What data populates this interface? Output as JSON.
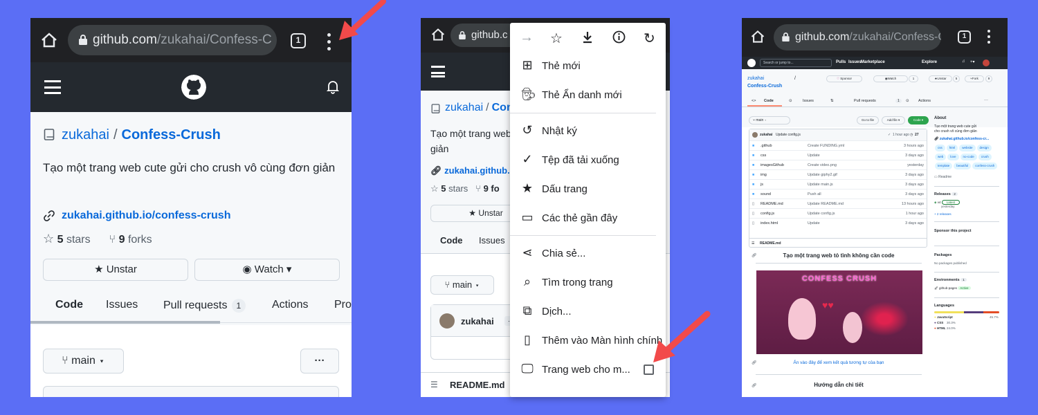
{
  "panel1": {
    "url_host": "github.com",
    "url_path": "/zukahai/Confess-C",
    "tab_count": "1",
    "owner": "zukahai",
    "separator": "/",
    "repo": "Confess-Crush",
    "description": "Tạo một trang web cute gửi cho crush vô cùng đơn giản",
    "website": "zukahai.github.io/confess-crush",
    "stars_count": "5",
    "stars_label": "stars",
    "forks_count": "9",
    "forks_label": "forks",
    "unstar": "Unstar",
    "watch": "Watch",
    "tabs": [
      "Code",
      "Issues",
      "Pull requests",
      "Actions",
      "Pro"
    ],
    "pr_count": "1",
    "branch": "main",
    "more": "···"
  },
  "panel2": {
    "url_host": "github.c",
    "owner": "zukahai",
    "separator": "/",
    "repo_part": "Con",
    "desc_part": "Tạo một trang web",
    "desc_part2": "giản",
    "website_part": "zukahai.github.io",
    "stars_count": "5",
    "stars_label": "stars",
    "forks_part": "9 fo",
    "unstar": "Unstar",
    "tabs": [
      "Code",
      "Issues"
    ],
    "branch": "main",
    "commit_user": "zukahai",
    "commit_more": "···",
    "readme": "README.md",
    "menu": [
      {
        "label": "Thẻ mới",
        "icon": "new-tab-icon"
      },
      {
        "label": "Thẻ Ẩn danh mới",
        "icon": "incognito-icon"
      },
      {
        "label": "Nhật ký",
        "icon": "history-icon"
      },
      {
        "label": "Tệp đã tải xuống",
        "icon": "downloads-icon"
      },
      {
        "label": "Dấu trang",
        "icon": "bookmarks-icon"
      },
      {
        "label": "Các thẻ gần đây",
        "icon": "recent-tabs-icon"
      },
      {
        "label": "Chia sẻ...",
        "icon": "share-icon"
      },
      {
        "label": "Tìm trong trang",
        "icon": "find-icon"
      },
      {
        "label": "Dịch...",
        "icon": "translate-icon"
      },
      {
        "label": "Thêm vào Màn hình chính",
        "icon": "add-home-icon"
      },
      {
        "label": "Trang web cho m...",
        "icon": "desktop-icon"
      }
    ]
  },
  "panel3": {
    "url_host": "github.com",
    "url_path": "/zukahai/Confess-C",
    "tab_count": "1",
    "search_placeholder": "Search or jump to...",
    "nav": [
      "Pulls",
      "Issues",
      "Marketplace",
      "Explore"
    ],
    "owner": "zukahai",
    "separator": "/",
    "repo": "Confess-Crush",
    "sponsor": "Sponsor",
    "watch": "Watch",
    "watch_count": "1",
    "unstar": "Unstar",
    "star_count": "5",
    "fork": "Fork",
    "fork_count": "9",
    "tabs": [
      "Code",
      "Issues",
      "Pull requests",
      "Actions"
    ],
    "pr_count": "1",
    "branch": "main",
    "go_to_file": "Go to file",
    "add_file": "Add file",
    "code_btn": "Code",
    "commit_user": "zukahai",
    "commit_msg": "Update config.js",
    "commit_time": "1 hour ago",
    "commit_count": "27",
    "files": [
      {
        "name": ".github",
        "msg": "Create FUNDING.yml",
        "time": "3 hours ago"
      },
      {
        "name": "css",
        "msg": "Update",
        "time": "3 days ago"
      },
      {
        "name": "imagesGithub",
        "msg": "Create video.png",
        "time": "yesterday"
      },
      {
        "name": "img",
        "msg": "Update giphy2.gif",
        "time": "3 days ago"
      },
      {
        "name": "js",
        "msg": "Update main.js",
        "time": "3 days ago"
      },
      {
        "name": "sound",
        "msg": "Push all",
        "time": "3 days ago"
      },
      {
        "name": "README.md",
        "msg": "Update README.md",
        "time": "13 hours ago"
      },
      {
        "name": "config.js",
        "msg": "Update config.js",
        "time": "1 hour ago"
      },
      {
        "name": "index.html",
        "msg": "Update",
        "time": "3 days ago"
      }
    ],
    "readme_label": "README.md",
    "readme_title": "Tạo một trang web tỏ tình không cần code",
    "banner_text": "CONFESS CRUSH",
    "readme_link": "Ấn vào đây để xem kết quả tương tự của bạn",
    "readme_h2": "Hướng dẫn chi tiết",
    "about": "About",
    "about_desc": "Tạo một trang web cute gửi cho crush vô cùng đơn giản",
    "about_link": "zukahai.github.io/confess-cr...",
    "topics": [
      "css",
      "html",
      "website",
      "design",
      "web",
      "love",
      "no-code",
      "crush",
      "template",
      "beautiful",
      "confess-crush"
    ],
    "readme_side": "Readme",
    "releases": "Releases",
    "releases_count": "2",
    "release_tag": "v4",
    "latest": "Latest",
    "release_date": "yesterday",
    "more_releases": "+ 2 releases",
    "sponsor_title": "Sponsor this project",
    "packages": "Packages",
    "no_packages": "No packages published",
    "environments": "Environments",
    "env_count": "1",
    "env_name": "github-pages",
    "env_status": "Active",
    "languages": "Languages",
    "langs": [
      {
        "name": "JavaScript",
        "pct": "45.7%",
        "color": "#f1e05a"
      },
      {
        "name": "CSS",
        "pct": "30.3%",
        "color": "#563d7c"
      },
      {
        "name": "HTML",
        "pct": "24.0%",
        "color": "#e34c26"
      }
    ]
  }
}
